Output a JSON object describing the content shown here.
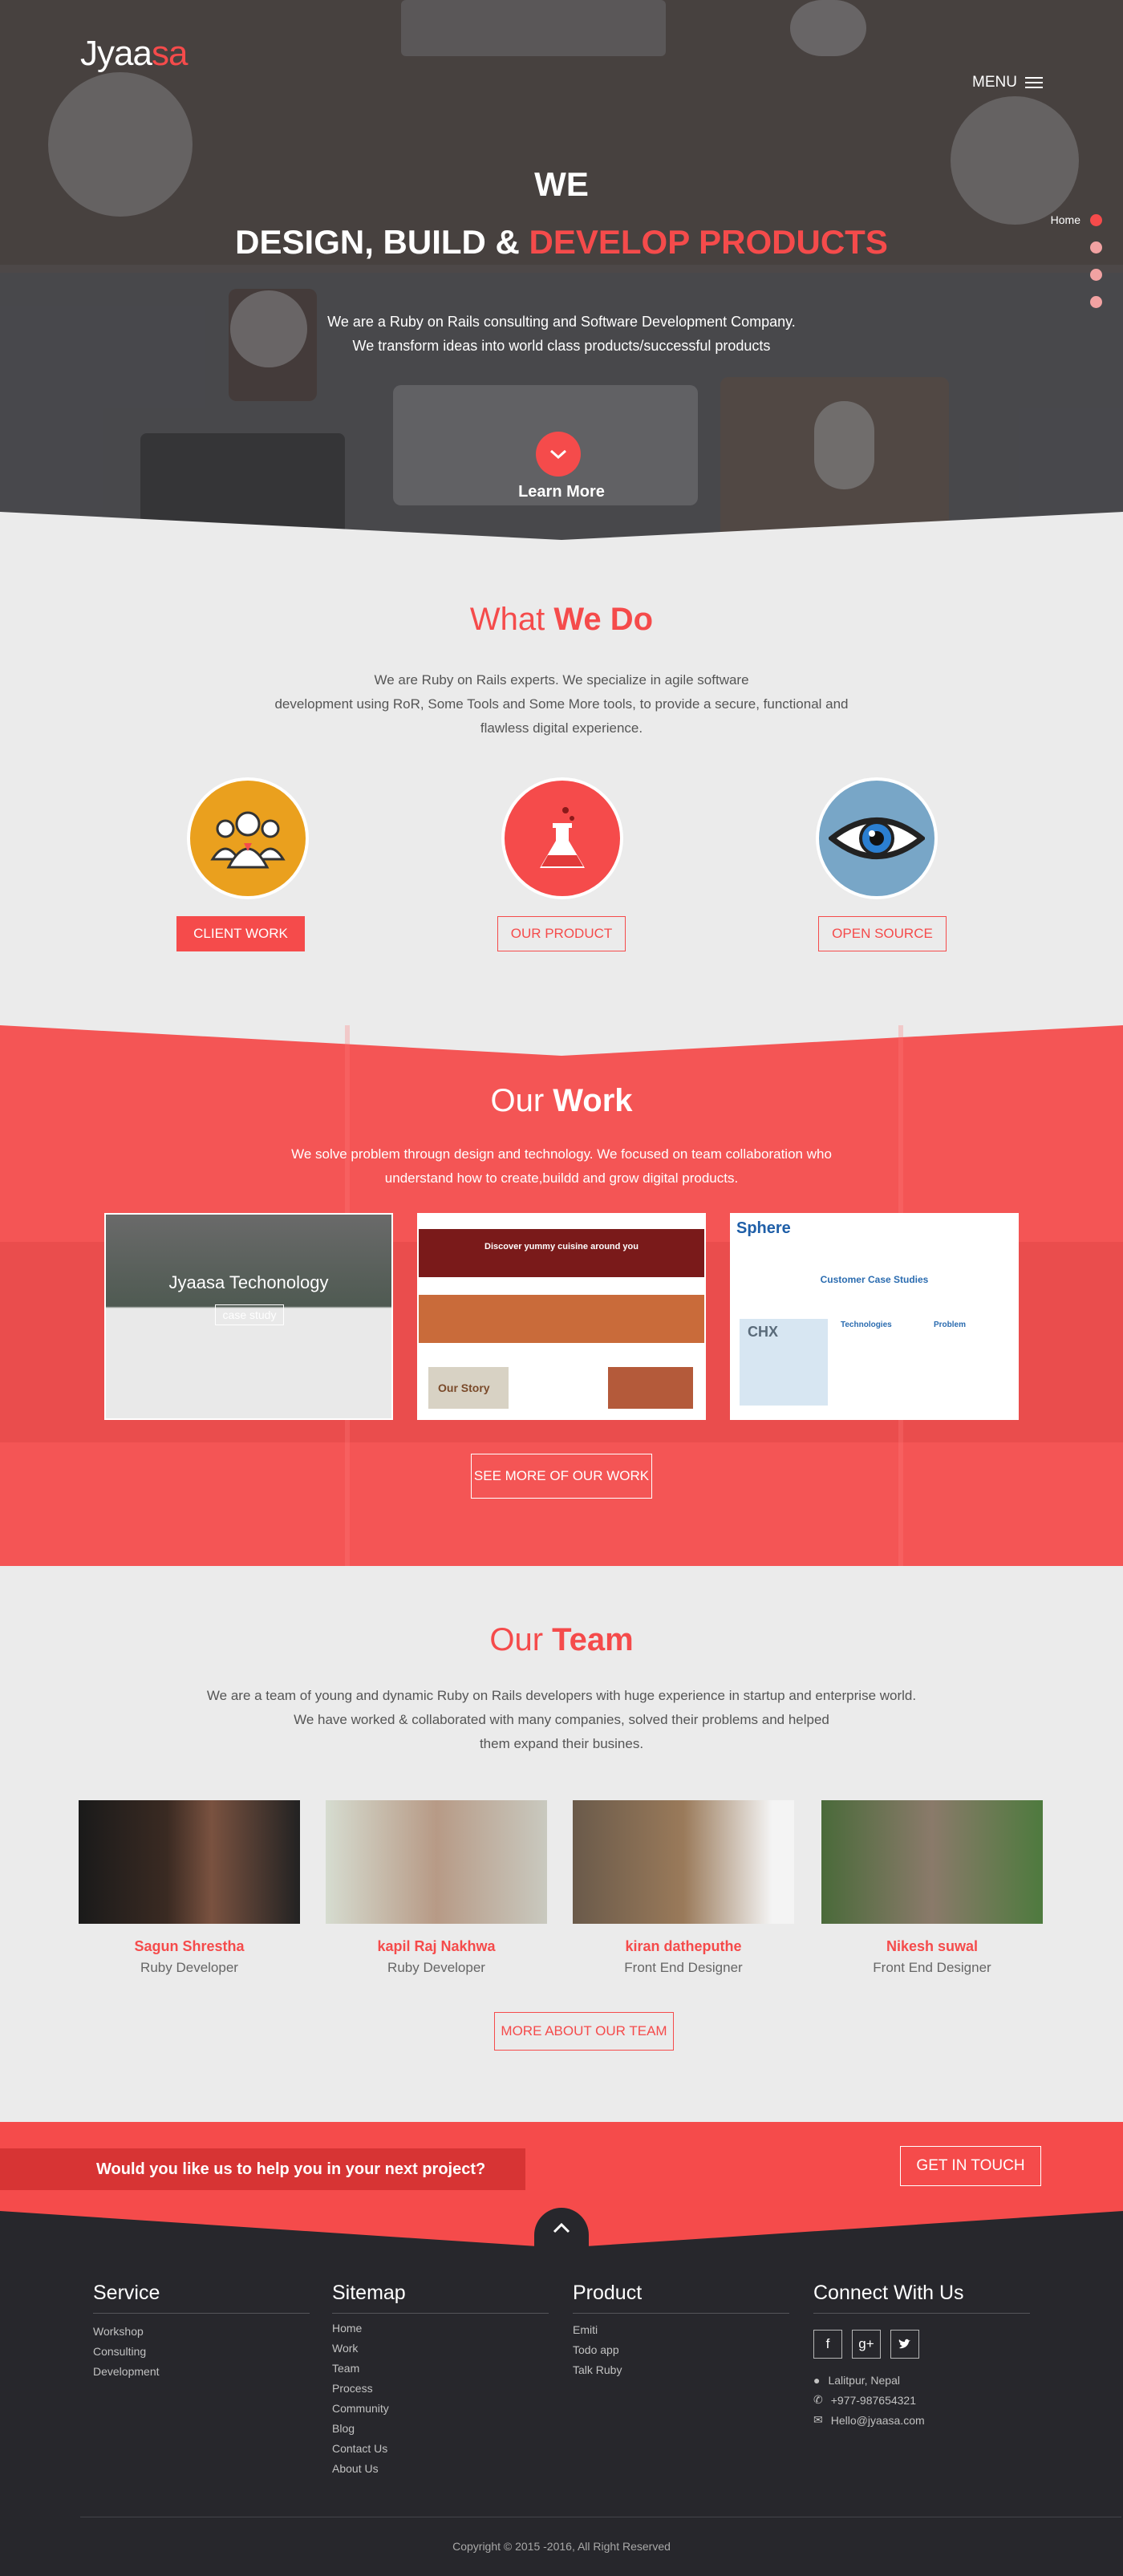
{
  "header": {
    "logo_main": "Jyaa",
    "logo_accent": "sa",
    "menu_label": "MENU",
    "dots_active_label": "Home"
  },
  "hero": {
    "we": "WE",
    "headline_white": "DESIGN, BUILD &",
    "headline_red": "DEVELOP PRODUCTS",
    "sub_line1": "We are a Ruby on Rails consulting and Software Development Company.",
    "sub_line2": "We transform ideas into world class products/successful products",
    "learn_more": "Learn More"
  },
  "what_we_do": {
    "title_light": "What",
    "title_bold": "We Do",
    "text_line1": "We are Ruby on Rails experts. We specialize in agile software",
    "text_line2": "development using RoR, Some Tools and Some More tools, to provide a secure, functional and",
    "text_line3": "flawless digital experience.",
    "buttons": [
      "CLIENT WORK",
      "OUR PRODUCT",
      "OPEN SOURCE"
    ]
  },
  "our_work": {
    "title_light": "Our",
    "title_bold": "Work",
    "text_line1": "We solve problem througn design and technology. We focused on team collaboration who",
    "text_line2": "understand how to create,buildd and grow digital products.",
    "shot1_title": "Jyaasa Techonology",
    "shot1_button": "case study",
    "shot2_banner": "Discover yummy cuisine around you",
    "shot2_story": "Our Story",
    "shot3_brand": "Sphere",
    "shot3_heading": "Customer Case Studies",
    "shot3_logo": "CHX",
    "shot3_col1": "Technologies",
    "shot3_col2": "Problem",
    "see_more": "SEE MORE OF OUR WORK"
  },
  "team": {
    "title_light": "Our",
    "title_bold": "Team",
    "text_line1": "We are a team of young and dynamic Ruby on Rails developers with huge experience in startup and enterprise world.",
    "text_line2": "We have worked & collaborated with many companies, solved their problems and helped",
    "text_line3": "them expand their busines.",
    "members": [
      {
        "name": "Sagun Shrestha",
        "role": "Ruby Developer"
      },
      {
        "name": "kapil Raj Nakhwa",
        "role": "Ruby Developer"
      },
      {
        "name": "kiran datheputhe",
        "role": "Front End Designer"
      },
      {
        "name": "Nikesh suwal",
        "role": "Front End Designer"
      }
    ],
    "more_button": "MORE ABOUT OUR TEAM"
  },
  "cta": {
    "question": "Would you like us to help you in your next project?",
    "button": "GET IN TOUCH"
  },
  "footer": {
    "service_title": "Service",
    "service_links": [
      "Workshop",
      "Consulting",
      "Development"
    ],
    "sitemap_title": "Sitemap",
    "sitemap_links": [
      "Home",
      "Work",
      "Team",
      "Process",
      "Community",
      "Blog",
      "Contact Us",
      "About Us"
    ],
    "product_title": "Product",
    "product_links": [
      "Emiti",
      "Todo app",
      "Talk Ruby"
    ],
    "connect_title": "Connect With Us",
    "address": "Lalitpur, Nepal",
    "phone": "+977-987654321",
    "email": "Hello@jyaasa.com",
    "copyright": "Copyright © 2015 -2016, All Right Reserved"
  },
  "colors": {
    "accent": "#f54b4b",
    "footer_bg": "#27272c",
    "page_bg": "#ebebeb"
  }
}
